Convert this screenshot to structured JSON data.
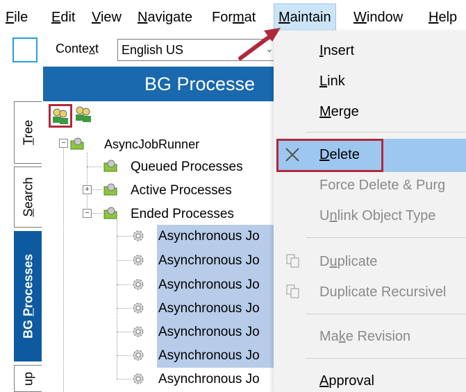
{
  "menubar": {
    "items": [
      {
        "label": "File",
        "u": "F",
        "rest": "ile"
      },
      {
        "label": "Edit",
        "u": "E",
        "rest": "dit"
      },
      {
        "label": "View",
        "u": "V",
        "rest": "iew"
      },
      {
        "label": "Navigate",
        "u": "N",
        "rest": "avigate"
      },
      {
        "label": "Format",
        "pre": "For",
        "u": "m",
        "rest": "at"
      },
      {
        "label": "Maintain",
        "u": "M",
        "rest": "aintain"
      },
      {
        "label": "Window",
        "u": "W",
        "rest": "indow"
      },
      {
        "label": "Help",
        "u": "H",
        "rest": "elp"
      }
    ]
  },
  "toolbar": {
    "context_label_pre": "Conte",
    "context_label_u": "x",
    "context_label_post": "t",
    "context_value": "English US"
  },
  "left_tabs": [
    {
      "label": "Tree",
      "u": "T",
      "rest": "ree"
    },
    {
      "label": "Search",
      "u": "S",
      "rest": "earch"
    },
    {
      "label": "BG Processes",
      "pre": "BG ",
      "u": "P",
      "rest": "rocesses"
    },
    {
      "label": "up",
      "u": "",
      "rest": "up"
    }
  ],
  "panel": {
    "title": "BG Processe"
  },
  "tree": {
    "root": "AsyncJobRunner",
    "children": [
      "Queued Processes",
      "Active Processes",
      "Ended Processes"
    ],
    "ended_items": [
      "Asynchronous Jo",
      "Asynchronous Jo",
      "Asynchronous Jo",
      "Asynchronous Jo",
      "Asynchronous Jo",
      "Asynchronous Jo",
      "Asynchronous Jo"
    ]
  },
  "maintain_menu": {
    "insert": {
      "u": "I",
      "rest": "nsert"
    },
    "link": {
      "u": "L",
      "rest": "ink"
    },
    "merge": {
      "u": "M",
      "rest": "erge"
    },
    "delete": {
      "u": "D",
      "rest": "elete"
    },
    "force_delete": "Force Delete & Purg",
    "unlink_pre": "U",
    "unlink_u": "n",
    "unlink_rest": "link Object Type",
    "duplicate_pre": "D",
    "duplicate_u": "u",
    "duplicate_rest": "plicate",
    "duplicate_recursive": "Duplicate Recursivel",
    "make_revision_pre": "Ma",
    "make_revision_u": "k",
    "make_revision_rest": "e Revision",
    "approval": {
      "u": "A",
      "rest": "pproval"
    }
  },
  "colors": {
    "accent": "#1a68ad",
    "highlight": "#b0283c",
    "selection": "#b7cce9",
    "menu_hover": "#9ec7f0"
  }
}
